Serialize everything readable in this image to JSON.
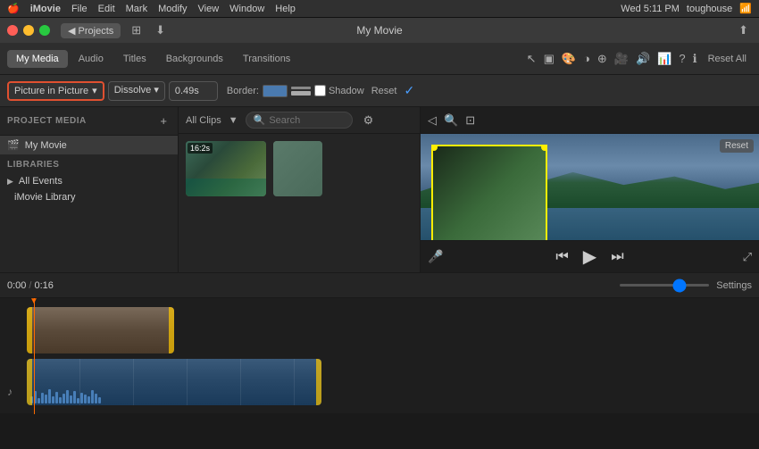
{
  "app": {
    "name": "iMovie",
    "title": "My Movie",
    "user": "toughouse"
  },
  "menubar": {
    "items": [
      "iMovie",
      "File",
      "Edit",
      "Mark",
      "Modify",
      "View",
      "Window",
      "Help"
    ],
    "right": {
      "time": "Wed 5:11 PM",
      "user": "toughouse"
    }
  },
  "titlebar": {
    "projects_label": "◀ Projects"
  },
  "toolbar": {
    "tabs": [
      "My Media",
      "Audio",
      "Titles",
      "Backgrounds",
      "Transitions"
    ],
    "active": "My Media",
    "reset_all": "Reset All"
  },
  "toolbar2": {
    "pip_label": "Picture in Picture",
    "dissolve_label": "Dissolve",
    "duration": "0.49s",
    "border_label": "Border:",
    "shadow_label": "Shadow",
    "reset_label": "Reset"
  },
  "left_panel": {
    "project_media_label": "PROJECT MEDIA",
    "my_movie_label": "My Movie",
    "libraries_label": "LIBRARIES",
    "all_events_label": "All Events",
    "imovie_library_label": "iMovie Library"
  },
  "content": {
    "all_clips_label": "All Clips",
    "search_placeholder": "Search",
    "clips": [
      {
        "duration": "16:2s",
        "id": "clip1"
      },
      {
        "duration": "",
        "id": "clip2"
      }
    ]
  },
  "timeline": {
    "time_current": "0:00",
    "time_total": "0:16",
    "settings_label": "Settings"
  },
  "preview": {
    "reset_label": "Reset"
  },
  "controls": {
    "rewind": "⏮",
    "play": "▶",
    "forward": "⏭"
  }
}
